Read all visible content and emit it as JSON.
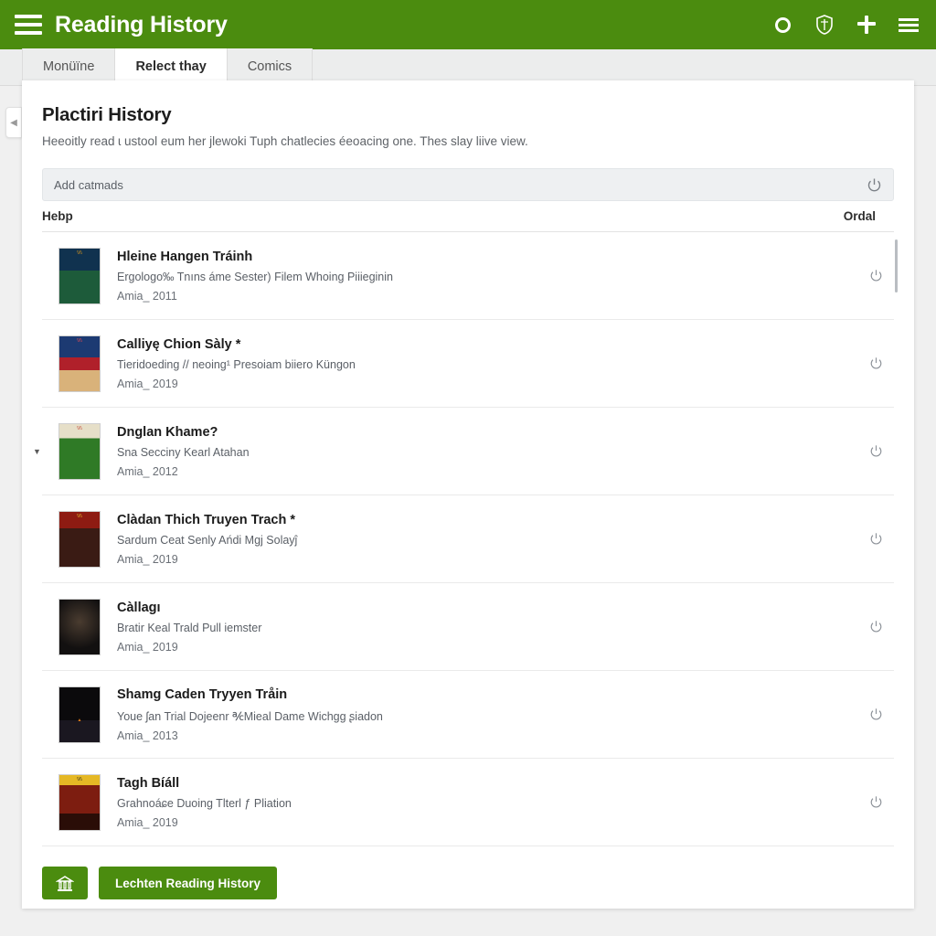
{
  "appbar": {
    "title": "Reading History",
    "menu_icon": "hamburger-icon",
    "actions": [
      {
        "name": "circle-icon",
        "label": "O"
      },
      {
        "name": "shield-icon",
        "label": ""
      },
      {
        "name": "plus-icon",
        "label": "+"
      },
      {
        "name": "hamburger-icon",
        "label": ""
      }
    ]
  },
  "tabs": [
    {
      "label": "Monüïne",
      "active": false
    },
    {
      "label": "Relect thay",
      "active": true
    },
    {
      "label": "Comics",
      "active": false
    }
  ],
  "collapse_handle": {
    "glyph": "◀"
  },
  "main": {
    "title": "Plactiri History",
    "subtitle": "Heeoitly read ɩ ustool eum her jlewoki Tuph chatlecies éeoacing one. Thes slay liive view."
  },
  "search": {
    "placeholder": "Add catmads",
    "value": "Add catmads",
    "action_icon": "power-icon"
  },
  "list_header": {
    "left": "Hebp",
    "right": "Ordal"
  },
  "rows": [
    {
      "title": "Hleine Hangen Tráinh",
      "description": "Ergologo‰ Tnıns áme Sester) Filem Whoing Piiieginin",
      "meta": "Amia_ 2011",
      "cover_colors": [
        "#10324f",
        "#1d5b3a",
        "#f0a016"
      ],
      "caret": false,
      "action_icon": "power-icon"
    },
    {
      "title": "Calliyę Chion Sàly  *",
      "description": "Tieridoeding // neoing¹ Presoiam biiero Küngon",
      "meta": "Amia_ 2019",
      "cover_colors": [
        "#1c3a72",
        "#b0202a",
        "#d9b27a"
      ],
      "caret": false,
      "action_icon": "power-icon"
    },
    {
      "title": "Dnglan Khame?",
      "description": "Sna Secciny Kearl Atahan",
      "meta": "Amia_ 2012",
      "cover_colors": [
        "#2f7a26",
        "#e6dfc8",
        "#c0392b"
      ],
      "caret": true,
      "action_icon": "power-icon"
    },
    {
      "title": "Clàdan Thich Truyen Trach *",
      "description": "Sardum Ceat Senly Ańdi Mgj Solayĵ",
      "meta": "Amia_ 2019",
      "cover_colors": [
        "#8e1b12",
        "#e8c22a",
        "#3a1b14"
      ],
      "caret": false,
      "action_icon": "power-icon"
    },
    {
      "title": "Càllagı",
      "description": "Bratir Keal Trald Pull iemster",
      "meta": "Amia_ 2019",
      "cover_colors": [
        "#121010",
        "#4a3c30",
        "#0a0908"
      ],
      "caret": false,
      "action_icon": "power-icon"
    },
    {
      "title": "Shamg Caden Tryyen Tråin",
      "description": "Youe ʃan Trial Dojeenr ℀Mieal Dame Wichgg ʂiadon",
      "meta": "Amia_ 2013",
      "cover_colors": [
        "#0b0a0c",
        "#e07a18",
        "#1a1720"
      ],
      "caret": false,
      "action_icon": "power-icon"
    },
    {
      "title": "Tagh Bíáll",
      "description": "Grahnoáɕe Duoing Tlterl ƒ Pliation",
      "meta": "Amia_ 2019",
      "cover_colors": [
        "#7d1d10",
        "#e5b825",
        "#2a0d07"
      ],
      "caret": false,
      "action_icon": "power-icon"
    }
  ],
  "footer": {
    "home_button_icon": "bank-icon",
    "primary_button": "Lechten Reading History"
  },
  "colors": {
    "brand_green": "#4b8c0f",
    "tab_strip": "#eceded",
    "card_bg": "#ffffff",
    "page_bg": "#f0f0f0",
    "search_bg": "#eef0f2",
    "text_primary": "#1b1b1b",
    "text_secondary": "#5a5f66"
  }
}
